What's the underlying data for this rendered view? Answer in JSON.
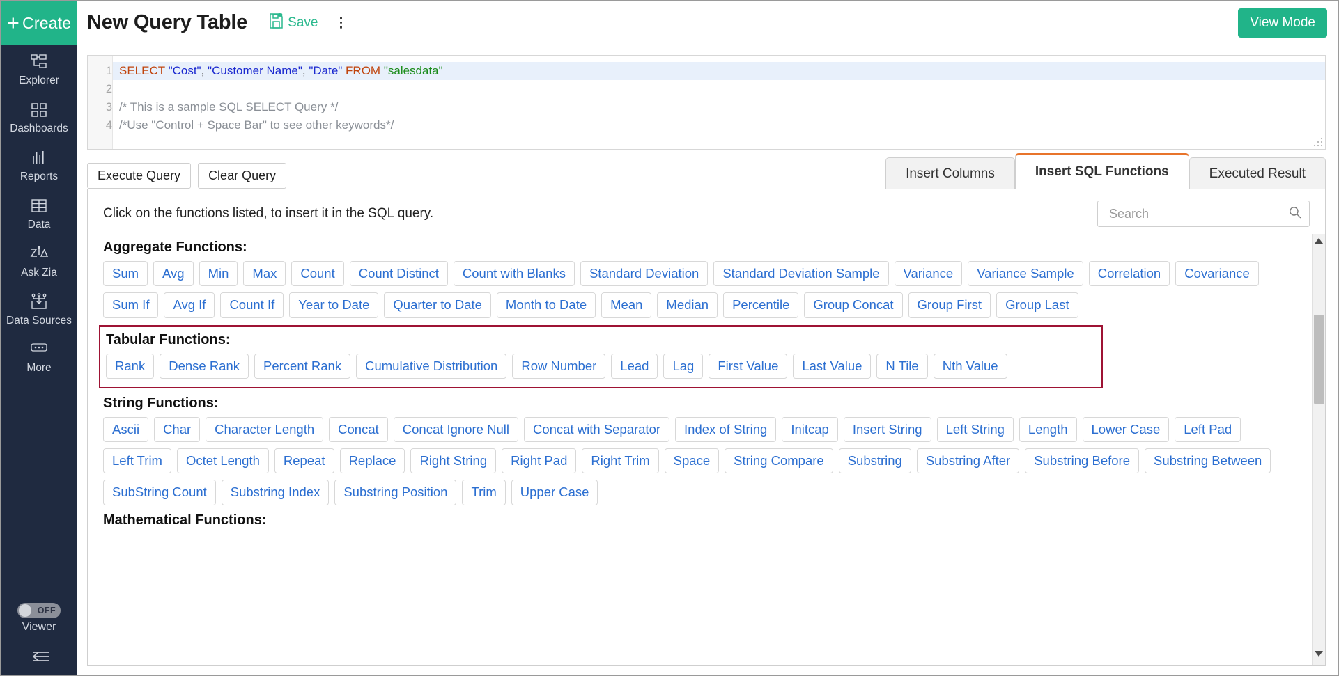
{
  "sidebar": {
    "create_label": "Create",
    "items": [
      {
        "label": "Explorer",
        "icon": "hierarchy-icon"
      },
      {
        "label": "Dashboards",
        "icon": "grid-icon"
      },
      {
        "label": "Reports",
        "icon": "bar-chart-icon"
      },
      {
        "label": "Data",
        "icon": "table-icon"
      },
      {
        "label": "Ask Zia",
        "icon": "zia-icon"
      },
      {
        "label": "Data Sources",
        "icon": "data-sources-icon"
      },
      {
        "label": "More",
        "icon": "ellipsis-icon"
      }
    ],
    "viewer_toggle": {
      "state": "OFF",
      "label": "Viewer"
    }
  },
  "header": {
    "title": "New Query Table",
    "save_label": "Save",
    "view_mode_label": "View Mode"
  },
  "editor": {
    "lines": [
      {
        "num": "1",
        "active": true
      },
      {
        "num": "2",
        "active": false
      },
      {
        "num": "3",
        "active": false
      },
      {
        "num": "4",
        "active": false
      }
    ],
    "line1": {
      "select": "SELECT",
      "col1": "\"Cost\"",
      "sep1": ", ",
      "col2": "\"Customer Name\"",
      "sep2": ", ",
      "col3": "\"Date\"",
      "from": "FROM",
      "table": "\"salesdata\""
    },
    "line3": "/* This is a sample SQL SELECT Query */",
    "line4": "/*Use \"Control + Space Bar\" to see other keywords*/"
  },
  "actions": {
    "execute_label": "Execute Query",
    "clear_label": "Clear Query"
  },
  "tabs": [
    {
      "label": "Insert Columns",
      "active": false
    },
    {
      "label": "Insert SQL Functions",
      "active": true
    },
    {
      "label": "Executed Result",
      "active": false
    }
  ],
  "panel": {
    "hint": "Click on the functions listed, to insert it in the SQL query.",
    "search_placeholder": "Search",
    "search_value": "",
    "groups": [
      {
        "title": "Aggregate Functions:",
        "highlight": false,
        "functions": [
          "Sum",
          "Avg",
          "Min",
          "Max",
          "Count",
          "Count Distinct",
          "Count with Blanks",
          "Standard Deviation",
          "Standard Deviation Sample",
          "Variance",
          "Variance Sample",
          "Correlation",
          "Covariance",
          "Sum If",
          "Avg If",
          "Count If",
          "Year to Date",
          "Quarter to Date",
          "Month to Date",
          "Mean",
          "Median",
          "Percentile",
          "Group Concat",
          "Group First",
          "Group Last"
        ]
      },
      {
        "title": "Tabular Functions:",
        "highlight": true,
        "functions": [
          "Rank",
          "Dense Rank",
          "Percent Rank",
          "Cumulative Distribution",
          "Row Number",
          "Lead",
          "Lag",
          "First Value",
          "Last Value",
          "N Tile",
          "Nth Value"
        ]
      },
      {
        "title": "String Functions:",
        "highlight": false,
        "functions": [
          "Ascii",
          "Char",
          "Character Length",
          "Concat",
          "Concat Ignore Null",
          "Concat with Separator",
          "Index of String",
          "Initcap",
          "Insert String",
          "Left String",
          "Length",
          "Lower Case",
          "Left Pad",
          "Left Trim",
          "Octet Length",
          "Repeat",
          "Replace",
          "Right String",
          "Right Pad",
          "Right Trim",
          "Space",
          "String Compare",
          "Substring",
          "Substring After",
          "Substring Before",
          "Substring Between",
          "SubString Count",
          "Substring Index",
          "Substring Position",
          "Trim",
          "Upper Case"
        ]
      },
      {
        "title": "Mathematical Functions:",
        "highlight": false,
        "functions": []
      }
    ]
  },
  "colors": {
    "brand_green": "#21b489",
    "sidebar_bg": "#1f2a40",
    "chip_text": "#2c6fd1",
    "active_tab_border": "#e8742b",
    "highlight_border": "#9e1334"
  }
}
